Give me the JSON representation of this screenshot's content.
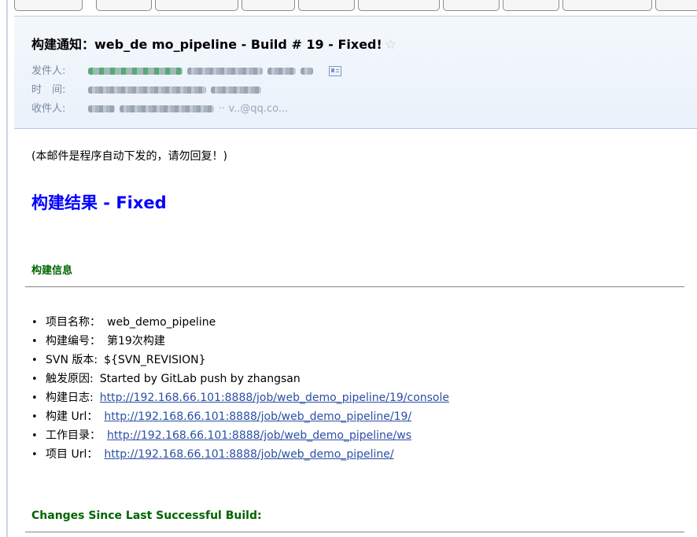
{
  "header": {
    "subject": "构建通知：web_de mo_pipeline - Build # 19 - Fixed!",
    "from_label": "发件人:",
    "time_label": "时　间:",
    "to_label": "收件人:",
    "to_visible_tail": "·· v..@qq.co..."
  },
  "body": {
    "auto_note": "(本邮件是程序自动下发的，请勿回复！)",
    "result_title": "构建结果 - Fixed",
    "info_section_title": "构建信息",
    "items": [
      {
        "label": "项目名称：",
        "value": "web_demo_pipeline",
        "is_link": false
      },
      {
        "label": "构建编号：",
        "value": "第19次构建",
        "is_link": false
      },
      {
        "label": "SVN 版本:",
        "value": "${SVN_REVISION}",
        "is_link": false
      },
      {
        "label": "触发原因:",
        "value": "Started by GitLab push by zhangsan",
        "is_link": false
      },
      {
        "label": "构建日志:",
        "value": "http://192.168.66.101:8888/job/web_demo_pipeline/19/console",
        "is_link": true
      },
      {
        "label": "构建  Url：",
        "value": "http://192.168.66.101:8888/job/web_demo_pipeline/19/",
        "is_link": true
      },
      {
        "label": "工作目录：",
        "value": "http://192.168.66.101:8888/job/web_demo_pipeline/ws",
        "is_link": true
      },
      {
        "label": "项目  Url：",
        "value": "http://192.168.66.101:8888/job/web_demo_pipeline/",
        "is_link": true
      }
    ],
    "changes_section_title": "Changes Since Last Successful Build:"
  },
  "icons": {
    "favorite": "star-outline-icon",
    "contact_card": "contact-card-icon"
  }
}
